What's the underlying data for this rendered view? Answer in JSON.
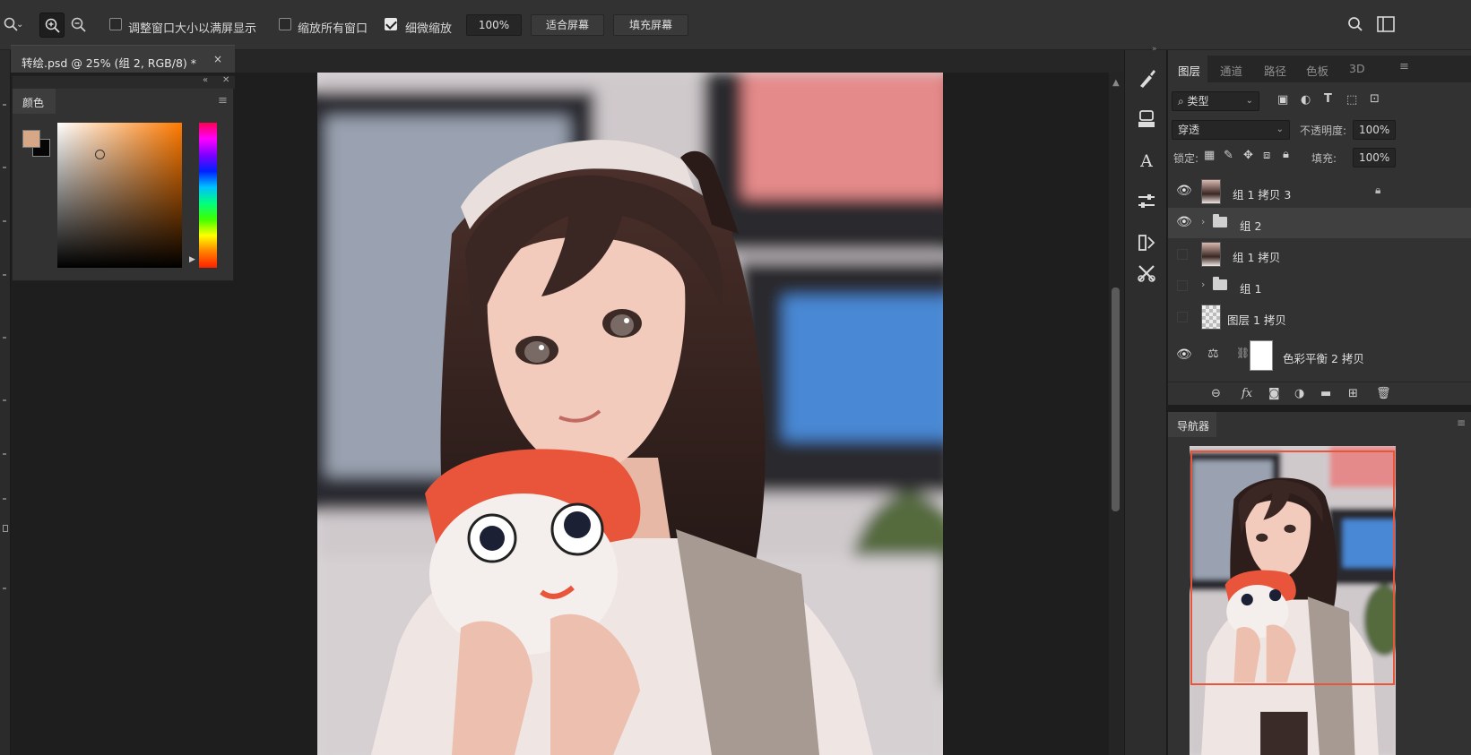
{
  "options_bar": {
    "checkbox_resize": "调整窗口大小以满屏显示",
    "checkbox_zoom_all": "缩放所有窗口",
    "checkbox_scrubby": "细微缩放",
    "zoom_value": "100%",
    "fit_screen": "适合屏幕",
    "fill_screen": "填充屏幕"
  },
  "document_tab": {
    "title": "转绘.psd @ 25% (组 2, RGB/8) *",
    "close": "×"
  },
  "color_panel": {
    "tab": "颜色",
    "foreground": "#d7a888",
    "background": "#050505"
  },
  "layers_panel": {
    "tabs": [
      "图层",
      "通道",
      "路径",
      "色板",
      "3D"
    ],
    "filter_kind": "类型",
    "blend_mode": "穿透",
    "opacity_label": "不透明度:",
    "opacity_value": "100%",
    "lock_label": "锁定:",
    "fill_label": "填充:",
    "fill_value": "100%",
    "layers": [
      {
        "name": "组 1 拷贝 3",
        "visible": true
      },
      {
        "name": "组 2",
        "visible": true
      },
      {
        "name": "组 1 拷贝",
        "visible": false
      },
      {
        "name": "组 1",
        "visible": false
      },
      {
        "name": "图层 1 拷贝",
        "visible": false
      },
      {
        "name": "色彩平衡 2 拷贝",
        "visible": true
      }
    ]
  },
  "navigator": {
    "tab": "导航器"
  },
  "colors": {
    "accent_view_box": "#e8553a"
  }
}
